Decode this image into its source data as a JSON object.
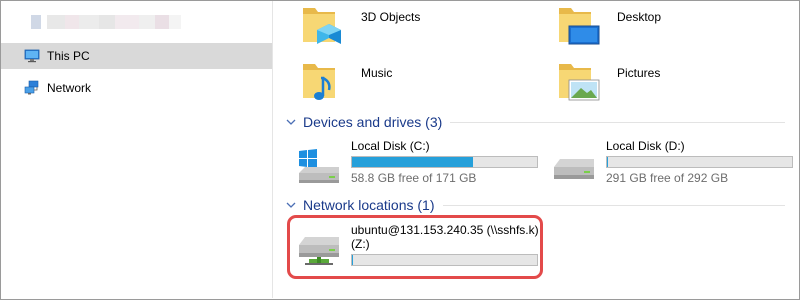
{
  "nav": {
    "items": [
      {
        "label": "This PC",
        "icon": "computer-icon",
        "selected": true
      },
      {
        "label": "Network",
        "icon": "network-icon",
        "selected": false
      }
    ]
  },
  "folders": [
    {
      "name": "3D Objects",
      "icon": "3d-objects-folder-icon"
    },
    {
      "name": "Desktop",
      "icon": "desktop-folder-icon"
    },
    {
      "name": "Music",
      "icon": "music-folder-icon"
    },
    {
      "name": "Pictures",
      "icon": "pictures-folder-icon"
    }
  ],
  "devices_group": {
    "title": "Devices and drives (3)",
    "drives": [
      {
        "name": "Local Disk (C:)",
        "free": "58.8 GB free of 171 GB",
        "used_fraction": 0.656,
        "icon": "windows-drive-icon"
      },
      {
        "name": "Local Disk (D:)",
        "free": "291 GB free of 292 GB",
        "used_fraction": 0.003,
        "icon": "hard-drive-icon"
      }
    ]
  },
  "network_group": {
    "title": "Network locations (1)",
    "drives": [
      {
        "name": "ubuntu@131.153.240.35 (\\\\sshfs.k)",
        "letter": "(Z:)",
        "used_fraction": 0.005,
        "icon": "network-drive-icon"
      }
    ]
  },
  "colors": {
    "bar_fill": "#26a0da",
    "group_title": "#1a3a8a",
    "highlight": "#e34a4a",
    "selected_nav": "#d9d9d9"
  }
}
